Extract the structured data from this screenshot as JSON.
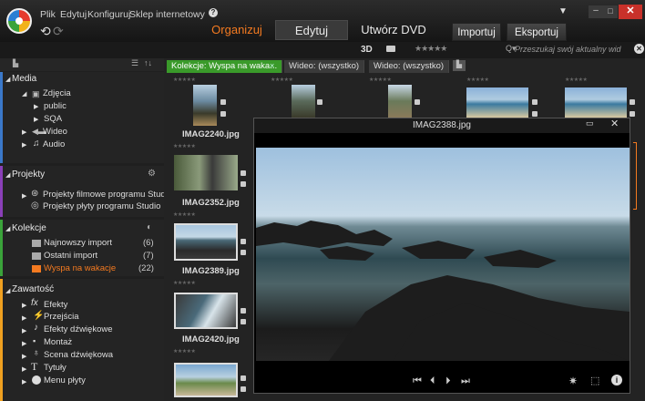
{
  "menu": [
    "Plik",
    "Edytuj",
    "Konfiguruj",
    "Sklep internetowy"
  ],
  "help": "?",
  "tabs": {
    "organize": "Organizuj",
    "edit": "Edytuj",
    "dvd": "Utwórz DVD"
  },
  "buttons": {
    "import": "Importuj",
    "export": "Eksportuj"
  },
  "toolbar": {
    "mode3d": "3D",
    "rating": "★★★★★"
  },
  "search": {
    "placeholder": "Przeszukaj swój aktualny wid"
  },
  "sidebar": {
    "media": {
      "title": "Media",
      "photos": "Zdjęcia",
      "public": "public",
      "sqa": "SQA",
      "video": "Wideo",
      "audio": "Audio"
    },
    "projects": {
      "title": "Projekty",
      "film": "Projekty filmowe programu Studio",
      "disc": "Projekty płyty programu Studio"
    },
    "collections": {
      "title": "Kolekcje",
      "items": [
        {
          "label": "Najnowszy import",
          "count": "(6)"
        },
        {
          "label": "Ostatni import",
          "count": "(7)"
        },
        {
          "label": "Wyspa na wakacje",
          "count": "(22)"
        }
      ]
    },
    "content": {
      "title": "Zawartość",
      "items": [
        "Efekty",
        "Przejścia",
        "Efekty dźwiękowe",
        "Montaż",
        "Scena dźwiękowa",
        "Tytuły",
        "Menu płyty"
      ]
    }
  },
  "content_tabs": [
    "Kolekcje: Wyspa na waka...",
    "Wideo: (wszystko)",
    "Wideo: (wszystko)"
  ],
  "thumbs": [
    "IMAG2240.jpg",
    "IMAG2352.jpg",
    "IMAG2389.jpg",
    "IMAG2420.jpg"
  ],
  "stars": "★★★★★",
  "preview": {
    "title": "IMAG2388.jpg"
  },
  "colors": {
    "accent": "#f47a20",
    "media": "#3a78c9",
    "projects": "#8a3fb8",
    "collections": "#3aa33a",
    "content": "#f0a020"
  }
}
